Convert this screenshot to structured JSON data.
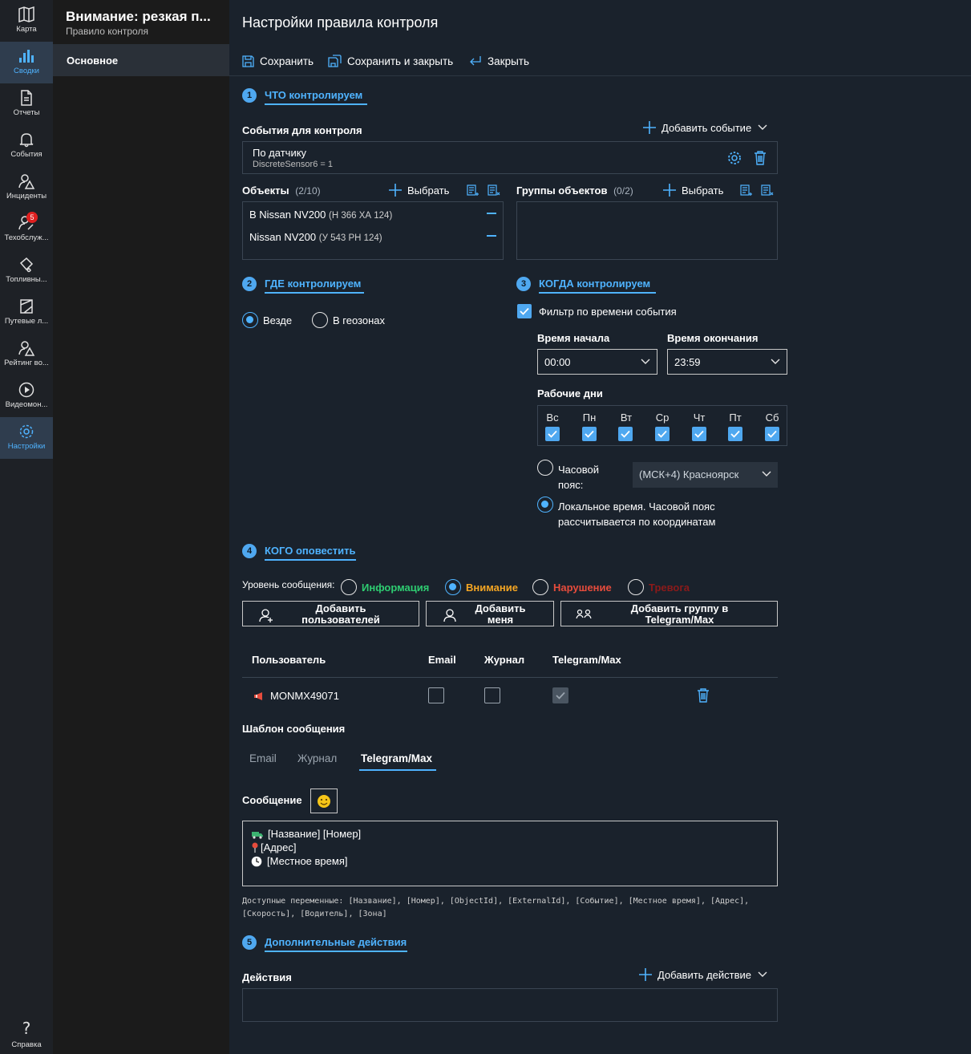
{
  "rail": {
    "items": [
      {
        "label": "Карта",
        "icon": "map-icon"
      },
      {
        "label": "Сводки",
        "icon": "bar-chart-icon",
        "active": true
      },
      {
        "label": "Отчеты",
        "icon": "document-icon"
      },
      {
        "label": "События",
        "icon": "bell-icon"
      },
      {
        "label": "Инциденты",
        "icon": "incident-icon"
      },
      {
        "label": "Техобслуж...",
        "icon": "maintenance-icon",
        "badge": "5"
      },
      {
        "label": "Топливны...",
        "icon": "fuel-icon"
      },
      {
        "label": "Путевые л...",
        "icon": "waybill-icon"
      },
      {
        "label": "Рейтинг во...",
        "icon": "driver-rating-icon"
      },
      {
        "label": "Видеомон...",
        "icon": "play-icon"
      },
      {
        "label": "Настройки",
        "icon": "gear-icon",
        "active": true
      }
    ],
    "help": "Справка"
  },
  "panel": {
    "title": "Внимание: резкая п...",
    "subtitle": "Правило контроля",
    "nav_selected": "Основное"
  },
  "main": {
    "page_title": "Настройки правила контроля",
    "toolbar": {
      "save": "Сохранить",
      "save_close": "Сохранить и закрыть",
      "close": "Закрыть"
    },
    "s1": {
      "num": "1",
      "title": "ЧТО контролируем",
      "events_label": "События для контроля",
      "add_event": "Добавить событие",
      "event_name": "По датчику",
      "event_detail": "DiscreteSensor6 = 1",
      "objects_label": "Объекты",
      "objects_count": "(2/10)",
      "select": "Выбрать",
      "objects": [
        {
          "name": "В Nissan NV200",
          "plate": "(Н 366 ХА 124)"
        },
        {
          "name": "Nissan NV200",
          "plate": "(У 543 РН 124)"
        }
      ],
      "groups_label": "Группы объектов",
      "groups_count": "(0/2)"
    },
    "s2": {
      "num": "2",
      "title": "ГДЕ контролируем",
      "everywhere": "Везде",
      "in_geozones": "В геозонах"
    },
    "s3": {
      "num": "3",
      "title": "КОГДА контролируем",
      "filter": "Фильтр по времени события",
      "start_label": "Время начала",
      "start_value": "00:00",
      "end_label": "Время окончания",
      "end_value": "23:59",
      "workdays_label": "Рабочие дни",
      "days": [
        "Вс",
        "Пн",
        "Вт",
        "Ср",
        "Чт",
        "Пт",
        "Сб"
      ],
      "tz_label_1": "Часовой",
      "tz_label_2": "пояс:",
      "tz_value": "(МСК+4) Красноярск",
      "local_1": "Локальное время. Часовой пояс",
      "local_2": "рассчитывается по координатам"
    },
    "s4": {
      "num": "4",
      "title": "КОГО оповестить",
      "level_label": "Уровень сообщения:",
      "levels": [
        {
          "label": "Информация",
          "color": "#2ecc71"
        },
        {
          "label": "Внимание",
          "color": "#f5a623"
        },
        {
          "label": "Нарушение",
          "color": "#e74c3c"
        },
        {
          "label": "Тревога",
          "color": "#8b1a1a"
        }
      ],
      "btn_add_users_1": "Добавить",
      "btn_add_users_2": "пользователей",
      "btn_add_me_1": "Добавить",
      "btn_add_me_2": "меня",
      "btn_add_group_1": "Добавить группу в",
      "btn_add_group_2": "Telegram/Max",
      "table_headers": [
        "Пользователь",
        "Email",
        "Журнал",
        "Telegram/Max"
      ],
      "user": "MONMX49071",
      "template_label": "Шаблон сообщения",
      "tabs": [
        "Email",
        "Журнал",
        "Telegram/Max"
      ],
      "message_label": "Сообщение",
      "message_lines": [
        "[Название] [Номер]",
        "[Адрес]",
        "[Местное время]"
      ],
      "vars_1": "Доступные переменные: [Название], [Номер], [ObjectId], [ExternalId], [Событие], [Местное время], [Адрес],",
      "vars_2": "[Скорость], [Водитель], [Зона]"
    },
    "s5": {
      "num": "5",
      "title": "Дополнительные действия",
      "actions_label": "Действия",
      "add_action": "Добавить действие"
    }
  },
  "colors": {
    "accent": "#4fb3ff",
    "background": "#1a222c",
    "rail": "#1e2126"
  }
}
